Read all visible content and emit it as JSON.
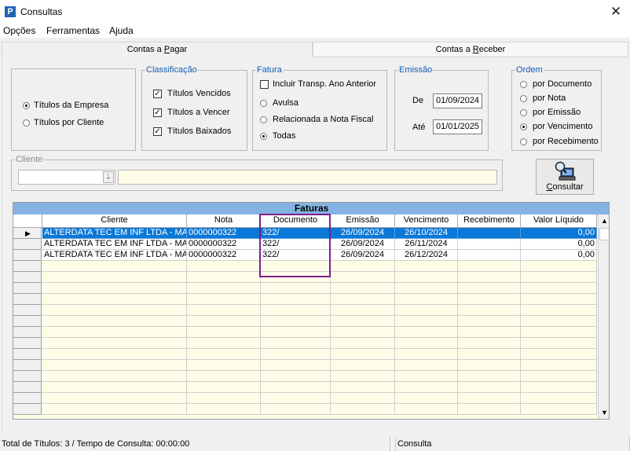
{
  "window": {
    "title": "Consultas",
    "icon": "P",
    "close": "✕"
  },
  "menu": [
    "Opções",
    "Ferramentas",
    "Ajuda"
  ],
  "tabs": {
    "pagar_pre": "Contas a ",
    "pagar_ul": "P",
    "pagar_post": "agar",
    "receber_pre": "Contas a ",
    "receber_ul": "R",
    "receber_post": "eceber"
  },
  "tipo": {
    "empresa": "Títulos da Empresa",
    "cliente": "Títulos por Cliente",
    "selected": "empresa"
  },
  "classificacao": {
    "legend": "Classificação",
    "vencidos": "Títulos Vencidos",
    "a_vencer": "Títulos a Vencer",
    "baixados": "Títulos Baixados",
    "checked": [
      true,
      true,
      true
    ]
  },
  "fatura": {
    "legend": "Fatura",
    "incluir": "Incluir Transp. Ano Anterior",
    "avulsa": "Avulsa",
    "relacionada": "Relacionada a Nota Fiscal",
    "todas": "Todas",
    "selected": "todas"
  },
  "emissao": {
    "legend": "Emissão",
    "de_label": "De",
    "de_value": "01/09/2024",
    "ate_label": "Até",
    "ate_value": "01/01/2025"
  },
  "ordem": {
    "legend": "Ordem",
    "opts": [
      "por Documento",
      "por Nota",
      "por Emissão",
      "por Vencimento",
      "por Recebimento"
    ],
    "selected": 3
  },
  "cliente_box": {
    "legend": "Cliente",
    "code": "",
    "name": ""
  },
  "consultar": {
    "ul": "C",
    "rest": "onsultar",
    "icon": "search-computer-icon"
  },
  "grid": {
    "caption": "Faturas",
    "columns": [
      "Cliente",
      "Nota",
      "Documento",
      "Emissão",
      "Vencimento",
      "Recebimento",
      "Valor Líquido"
    ],
    "rows": [
      {
        "cliente": "ALTERDATA TEC EM INF LTDA - MAN.",
        "nota": "0000000322",
        "documento": "322/",
        "emissao": "26/09/2024",
        "vencimento": "26/10/2024",
        "recebimento": "",
        "valor": "0,00"
      },
      {
        "cliente": "ALTERDATA TEC EM INF LTDA - MAN.",
        "nota": "0000000322",
        "documento": "322/",
        "emissao": "26/09/2024",
        "vencimento": "26/11/2024",
        "recebimento": "",
        "valor": "0,00"
      },
      {
        "cliente": "ALTERDATA TEC EM INF LTDA - MAN.",
        "nota": "0000000322",
        "documento": "322/",
        "emissao": "26/09/2024",
        "vencimento": "26/12/2024",
        "recebimento": "",
        "valor": "0,00"
      }
    ],
    "current_row_marker": "▶",
    "scroll_up": "▲",
    "scroll_down": "▼"
  },
  "status": {
    "left": "Total de Títulos: 3 / Tempo de Consulta: 00:00:00",
    "right": "Consulta"
  },
  "colors": {
    "accent": "#1459b8",
    "caption": "#86b4e2",
    "selection": "#0a78d7",
    "highlight": "#7a1f8c",
    "grid_bg": "#fffde8"
  }
}
